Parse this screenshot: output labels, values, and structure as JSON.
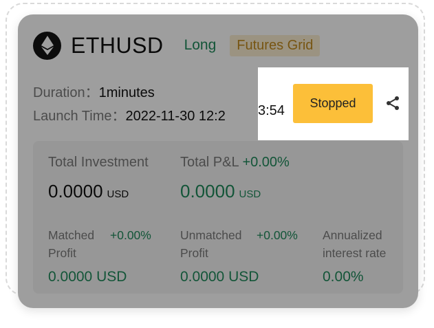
{
  "header": {
    "symbol": "ETHUSD",
    "direction": "Long",
    "strategy": "Futures Grid",
    "coin_icon": "ethereum-icon"
  },
  "info": {
    "duration_label": "Duration：",
    "duration_value": "1minutes",
    "launch_label": "Launch Time：",
    "launch_value_hidden": "2022-11-30 12:2",
    "launch_value_visible": "3:54"
  },
  "stats": {
    "total_investment_label": "Total Investment",
    "total_investment_value": "0.0000",
    "total_investment_unit": "USD",
    "total_pnl_label": "Total P&L",
    "total_pnl_pct": "+0.00%",
    "total_pnl_value": "0.0000",
    "total_pnl_unit": "USD",
    "matched_label_1": "Matched",
    "matched_label_2": "Profit",
    "matched_pct": "+0.00%",
    "matched_value": "0.0000 USD",
    "unmatched_label_1": "Unmatched",
    "unmatched_label_2": "Profit",
    "unmatched_pct": "+0.00%",
    "unmatched_value": "0.0000 USD",
    "annualized_label_1": "Annualized",
    "annualized_label_2": "interest rate",
    "annualized_value": "0.00%"
  },
  "actions": {
    "status_button": "Stopped",
    "share_icon": "share-icon"
  },
  "colors": {
    "positive": "#1f8a5b",
    "strategy_tag_text": "#c08a1e",
    "strategy_tag_bg": "#fbeed0",
    "status_button_bg": "#fcbf39"
  }
}
